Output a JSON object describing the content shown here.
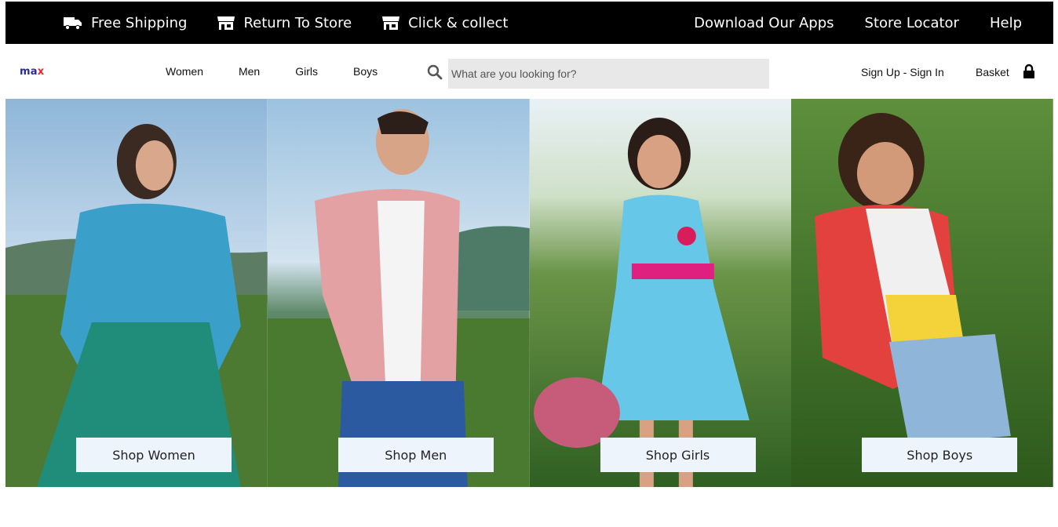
{
  "topbar": {
    "left_items": [
      {
        "label": "Free Shipping",
        "icon": "truck-icon"
      },
      {
        "label": "Return To Store",
        "icon": "store-icon"
      },
      {
        "label": "Click & collect",
        "icon": "store-icon"
      }
    ],
    "right_links": [
      "Download Our Apps",
      "Store Locator",
      "Help"
    ]
  },
  "navbar": {
    "logo": {
      "part1": "ma",
      "part2": "x"
    },
    "menu": [
      "Women",
      "Men",
      "Girls",
      "Boys"
    ],
    "search": {
      "placeholder": "What are you looking for?",
      "icon": "search-icon"
    },
    "account_label": "Sign Up - Sign In",
    "basket_label": "Basket",
    "basket_icon": "lock-icon"
  },
  "tiles": [
    {
      "cta": "Shop Women",
      "image": "woman-in-field-photo"
    },
    {
      "cta": "Shop Men",
      "image": "man-in-field-photo"
    },
    {
      "cta": "Shop Girls",
      "image": "girl-in-field-photo"
    },
    {
      "cta": "Shop Boys",
      "image": "boy-in-field-photo"
    }
  ],
  "colors": {
    "topbar_bg": "#000000",
    "logo_blue": "#2b2d8d",
    "logo_red": "#e3262d",
    "search_bg": "#e8e8e8",
    "button_bg": "#eef4fb"
  }
}
